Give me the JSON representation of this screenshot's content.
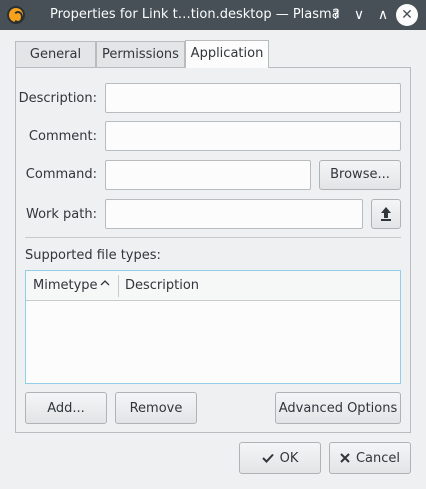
{
  "window": {
    "title": "Properties for Link t…tion.desktop — Plasma",
    "help_glyph": "?",
    "minimize_glyph": "∨",
    "maximize_glyph": "∧",
    "close_glyph": "✕"
  },
  "tabs": [
    {
      "label": "General",
      "active": false
    },
    {
      "label": "Permissions",
      "active": false
    },
    {
      "label": "Application",
      "active": true
    }
  ],
  "form": {
    "description_label": "Description:",
    "description_value": "",
    "comment_label": "Comment:",
    "comment_value": "",
    "command_label": "Command:",
    "command_value": "",
    "browse_label": "Browse...",
    "workpath_label": "Work path:",
    "workpath_value": "",
    "upload_icon": "upload-icon"
  },
  "filetypes": {
    "section_label": "Supported file types:",
    "columns": [
      "Mimetype",
      "Description"
    ],
    "rows": [],
    "sort_icon": "chevron-up-icon"
  },
  "actions": {
    "add_label": "Add...",
    "remove_label": "Remove",
    "advanced_label": "Advanced Options"
  },
  "dialog": {
    "ok_label": "OK",
    "cancel_label": "Cancel",
    "ok_icon": "check-icon",
    "cancel_icon": "x-icon"
  },
  "colors": {
    "titlebar": "#475057",
    "window_bg": "#eff0f1",
    "focus_border": "#93cee9"
  }
}
